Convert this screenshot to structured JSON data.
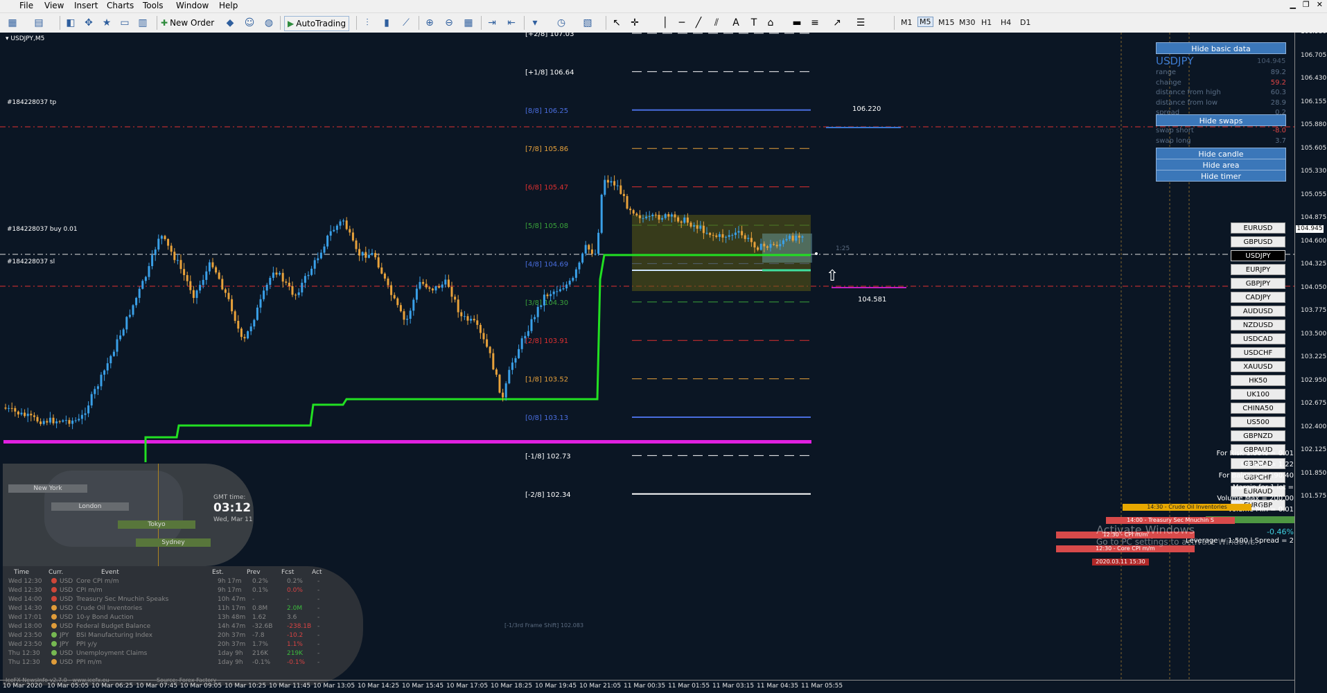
{
  "menu": [
    "File",
    "View",
    "Insert",
    "Charts",
    "Tools",
    "Window",
    "Help"
  ],
  "toolbar": {
    "new_order": "New Order",
    "autotrading": "AutoTrading",
    "timeframes": [
      "M1",
      "M5",
      "M15",
      "M30",
      "H1",
      "H4",
      "D1"
    ],
    "active_timeframe": "M5"
  },
  "chart": {
    "symbol_title": "USDJPY,M5",
    "order_labels": {
      "tp": "#184228037 tp",
      "buy": "#184228037 buy 0.01",
      "sl": "#184228037 sl"
    },
    "murrey_levels": [
      {
        "label": "[+2/8]",
        "price": "107.03",
        "color": "#ffffff"
      },
      {
        "label": "[+1/8]",
        "price": "106.64",
        "color": "#ffffff"
      },
      {
        "label": "[8/8]",
        "price": "106.25",
        "color": "#4a6ee0"
      },
      {
        "label": "[7/8]",
        "price": "105.86",
        "color": "#e8a23b"
      },
      {
        "label": "[6/8]",
        "price": "105.47",
        "color": "#e03030"
      },
      {
        "label": "[5/8]",
        "price": "105.08",
        "color": "#3aa33a"
      },
      {
        "label": "[4/8]",
        "price": "104.69",
        "color": "#4a6ee0"
      },
      {
        "label": "[3/8]",
        "price": "104.30",
        "color": "#3aa33a"
      },
      {
        "label": "[2/8]",
        "price": "103.91",
        "color": "#e03030"
      },
      {
        "label": "[1/8]",
        "price": "103.52",
        "color": "#e8a23b"
      },
      {
        "label": "[0/8]",
        "price": "103.13",
        "color": "#4a6ee0"
      },
      {
        "label": "[-1/8]",
        "price": "102.73",
        "color": "#ffffff"
      },
      {
        "label": "[-2/8]",
        "price": "102.34",
        "color": "#ffffff"
      }
    ],
    "frame_shift": "[-1/3rd Frame Shift]",
    "frame_shift_price": "102.083",
    "target_price": "106.220",
    "stop_price": "104.581",
    "ratio_label": "1:25",
    "current_price": "104.945",
    "price_axis": [
      "106.980",
      "106.705",
      "106.430",
      "106.155",
      "105.880",
      "105.605",
      "105.330",
      "105.055",
      "104.875",
      "104.600",
      "104.325",
      "104.050",
      "103.775",
      "103.500",
      "103.225",
      "102.950",
      "102.675",
      "102.400",
      "102.125",
      "101.850",
      "101.575"
    ],
    "time_axis": [
      "10 Mar 2020",
      "10 Mar 05:05",
      "10 Mar 06:25",
      "10 Mar 07:45",
      "10 Mar 09:05",
      "10 Mar 10:25",
      "10 Mar 11:45",
      "10 Mar 13:05",
      "10 Mar 14:25",
      "10 Mar 15:45",
      "10 Mar 17:05",
      "10 Mar 18:25",
      "10 Mar 19:45",
      "10 Mar 21:05",
      "11 Mar 00:35",
      "11 Mar 01:55",
      "11 Mar 03:15",
      "11 Mar 04:35",
      "11 Mar 05:55"
    ]
  },
  "sessions": {
    "labels": [
      "New York",
      "London",
      "Tokyo",
      "Sydney"
    ],
    "gmt_label": "GMT time:",
    "gmt_time": "03:12",
    "gmt_date": "Wed, Mar 11"
  },
  "news": {
    "headers": [
      "Time",
      "Curr.",
      "Event",
      "Est.",
      "Prev",
      "Fcst",
      "Act"
    ],
    "rows": [
      {
        "time": "Wed 12:30",
        "curr": "USD",
        "dot": "#d84a3a",
        "event": "Core CPI m/m",
        "est": "9h 17m",
        "prev": "0.2%",
        "fcst": "0.2%",
        "fcst_color": "#8b8b8b",
        "act": "-"
      },
      {
        "time": "Wed 12:30",
        "curr": "USD",
        "dot": "#d84a3a",
        "event": "CPI m/m",
        "est": "9h 17m",
        "prev": "0.1%",
        "fcst": "0.0%",
        "fcst_color": "#e04545",
        "act": "-"
      },
      {
        "time": "Wed 14:00",
        "curr": "USD",
        "dot": "#d84a3a",
        "event": "Treasury Sec Mnuchin Speaks",
        "est": "10h 47m",
        "prev": "-",
        "fcst": "-",
        "fcst_color": "#8b8b8b",
        "act": "-"
      },
      {
        "time": "Wed 14:30",
        "curr": "USD",
        "dot": "#e8a23b",
        "event": "Crude Oil Inventories",
        "est": "11h 17m",
        "prev": "0.8M",
        "fcst": "2.0M",
        "fcst_color": "#3ec13e",
        "act": "-"
      },
      {
        "time": "Wed 17:01",
        "curr": "USD",
        "dot": "#e8a23b",
        "event": "10-y Bond Auction",
        "est": "13h 48m",
        "prev": "1.62",
        "fcst": "3.6",
        "fcst_color": "#8b8b8b",
        "act": "-"
      },
      {
        "time": "Wed 18:00",
        "curr": "USD",
        "dot": "#e8a23b",
        "event": "Federal Budget Balance",
        "est": "14h 47m",
        "prev": "-32.6B",
        "fcst": "-238.1B",
        "fcst_color": "#e04545",
        "act": "-"
      },
      {
        "time": "Wed 23:50",
        "curr": "JPY",
        "dot": "#7bbf54",
        "event": "BSI Manufacturing Index",
        "est": "20h 37m",
        "prev": "-7.8",
        "fcst": "-10.2",
        "fcst_color": "#e04545",
        "act": "-"
      },
      {
        "time": "Wed 23:50",
        "curr": "JPY",
        "dot": "#7bbf54",
        "event": "PPI y/y",
        "est": "20h 37m",
        "prev": "1.7%",
        "fcst": "1.1%",
        "fcst_color": "#e04545",
        "act": "-"
      },
      {
        "time": "Thu 12:30",
        "curr": "USD",
        "dot": "#7bbf54",
        "event": "Unemployment Claims",
        "est": "1day 9h",
        "prev": "216K",
        "fcst": "219K",
        "fcst_color": "#3ec13e",
        "act": "-"
      },
      {
        "time": "Thu 12:30",
        "curr": "USD",
        "dot": "#e8a23b",
        "event": "PPI m/m",
        "est": "1day 9h",
        "prev": "-0.1%",
        "fcst": "-0.1%",
        "fcst_color": "#e04545",
        "act": "-"
      }
    ],
    "footer_left": "IceFX NewsInfo v2.7.0  -  www.icefx.eu",
    "footer_right": "Source: Forex Factory"
  },
  "panel": {
    "hide_basic": "Hide basic data",
    "symbol": "USDJPY",
    "symbol_price": "104.945",
    "rows": [
      {
        "label": "range",
        "value": "89.2"
      },
      {
        "label": "change",
        "value": "59.2",
        "value_color": "#e04545"
      },
      {
        "label": "distance from high",
        "value": "60.3"
      },
      {
        "label": "distance from low",
        "value": "28.9"
      },
      {
        "label": "spread",
        "value": "0.2"
      }
    ],
    "hide_swaps": "Hide swaps",
    "swap_rows": [
      {
        "label": "swap short",
        "value": "-8.0",
        "value_color": "#e04545"
      },
      {
        "label": "swap long",
        "value": "3.7"
      }
    ],
    "hide_candle": "Hide candle",
    "hide_area": "Hide area",
    "hide_timer": "Hide timer"
  },
  "symbols": [
    "EURUSD",
    "GBPUSD",
    "USDJPY",
    "EURJPY",
    "GBPJPY",
    "CADJPY",
    "AUDUSD",
    "NZDUSD",
    "USDCAD",
    "USDCHF",
    "XAUUSD",
    "HK50",
    "UK100",
    "CHINA50",
    "US500",
    "GBPNZD",
    "GBPAUD",
    "GBPCAD",
    "GBPCHF",
    "EURAUD",
    "EURGBP"
  ],
  "active_symbol": "USDJPY",
  "risk": {
    "lines": [
      "For Risk 1.00% = 0.01",
      "Lot Max = 1.22",
      "For Balance = 190.40",
      "Margin for 1 lot = ",
      "Volume Max = 200.00",
      "Volume Min = 0.01"
    ],
    "pct": "-0.46%",
    "leverage": "Leverage = 1:500 | Spread = 2"
  },
  "event_bars": [
    {
      "text": "14:30 - Crude Oil Inventories",
      "color": "#e8a800"
    },
    {
      "text": "14:00 - Treasury Sec Mnuchin S",
      "color": "#d84a4a"
    },
    {
      "text": "12:30 - CPI m/m",
      "color": "#d84a4a"
    },
    {
      "text": "12:30 - Core CPI m/m",
      "color": "#d84a4a"
    }
  ],
  "event_time_tag": "2020.03.11 15:30",
  "watermark": {
    "line1": "Activate Windows",
    "line2": "Go to PC settings to activate Windows."
  },
  "colors": {
    "background": "#0b1624",
    "bull": "#3aa0e8",
    "bear": "#e8a23b",
    "magenta": "#e020e0",
    "green_line": "#22e022",
    "button_blue": "#3b77b9"
  }
}
